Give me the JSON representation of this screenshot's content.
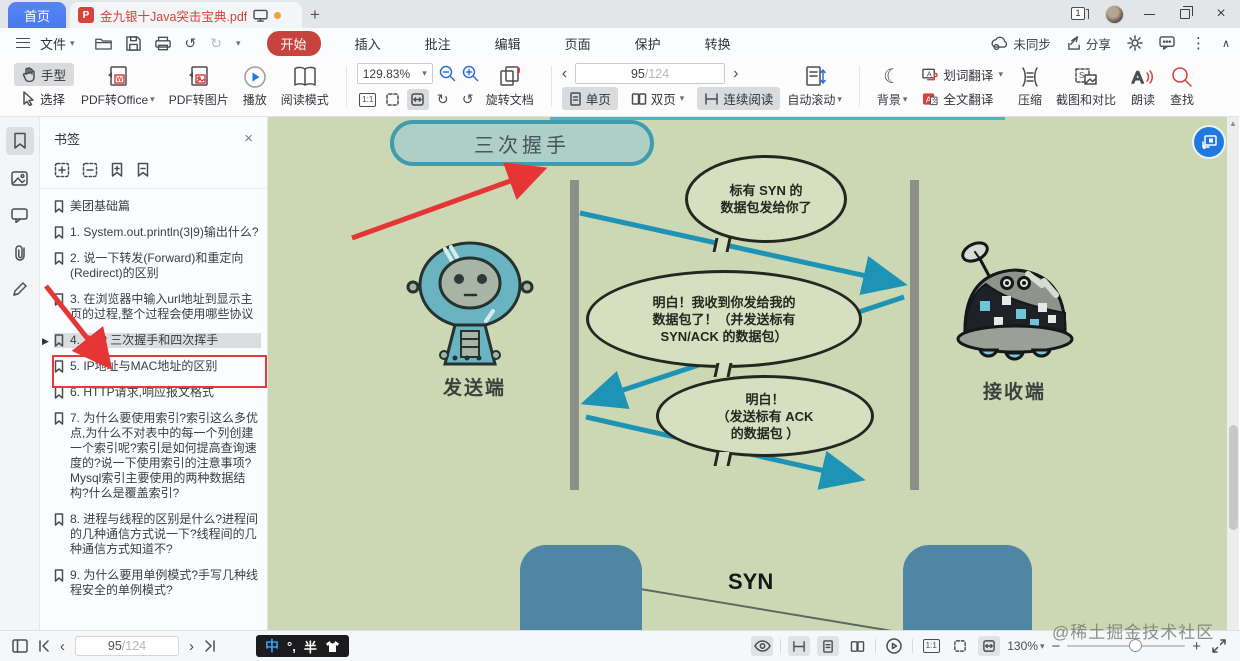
{
  "glyphs": {
    "caret_down": "▾",
    "chev_left": "‹",
    "chev_right": "›",
    "undo": "↺",
    "redo": "↻",
    "rotate_cw": "↻",
    "rotate_ccw": "↺",
    "play": "▶",
    "moon": "☾",
    "dots": "⋮",
    "close": "×",
    "minus": "−",
    "plus": "+",
    "chev_up": "∧",
    "tri_right": "▶",
    "scroll_up": "▲",
    "new_tab": "+"
  },
  "titlebar": {
    "home_tab": "首页",
    "doc_tab": "金九银十Java突击宝典.pdf",
    "window_count": "1"
  },
  "menubar": {
    "file_label": "文件",
    "tabs": [
      "开始",
      "插入",
      "批注",
      "编辑",
      "页面",
      "保护",
      "转换"
    ],
    "sync_label": "未同步",
    "share_label": "分享"
  },
  "ribbon": {
    "hand": "手型",
    "select": "选择",
    "pdf_to_office": "PDF转Office",
    "pdf_to_image": "PDF转图片",
    "play": "播放",
    "read_mode": "阅读模式",
    "zoom_value": "129.83%",
    "rotate_doc": "旋转文档",
    "single_page": "单页",
    "double_page": "双页",
    "continuous": "连续阅读",
    "auto_scroll": "自动滚动",
    "background": "背景",
    "word_translate": "划词翻译",
    "full_translate": "全文翻译",
    "compress": "压缩",
    "screenshot_compare": "截图和对比",
    "read_aloud": "朗读",
    "find": "查找"
  },
  "paging": {
    "current": "95",
    "sep": "/",
    "total": "124"
  },
  "sidebar": {
    "panel_title": "书签",
    "items": [
      {
        "label": "美团基础篇"
      },
      {
        "label": "1. System.out.println(3|9)输出什么?"
      },
      {
        "label": "2. 说一下转发(Forward)和重定向(Redirect)的区别"
      },
      {
        "label": "3. 在浏览器中输入url地址到显示主页的过程,整个过程会使用哪些协议"
      },
      {
        "label": "4. TCP 三次握手和四次挥手"
      },
      {
        "label": "5. IP地址与MAC地址的区别"
      },
      {
        "label": "6. HTTP请求,响应报文格式"
      },
      {
        "label": "7. 为什么要使用索引?索引这么多优点,为什么不对表中的每一个列创建一个索引呢?索引是如何提高查询速度的?说一下使用索引的注意事项?Mysql索引主要使用的两种数据结构?什么是覆盖索引?"
      },
      {
        "label": "8. 进程与线程的区别是什么?进程间的几种通信方式说一下?线程间的几种通信方式知道不?"
      },
      {
        "label": "9. 为什么要用单例模式?手写几种线程安全的单例模式?"
      }
    ]
  },
  "document": {
    "title_box": "三次握手",
    "bubbles": [
      {
        "lines": [
          "标有 SYN 的",
          "数据包发给你了"
        ]
      },
      {
        "lines": [
          "明白！我收到你发给我的",
          "数据包了！（并发送标有",
          "SYN/ACK 的数据包）"
        ]
      },
      {
        "lines": [
          "明白！",
          "（发送标有 ACK",
          "的数据包 ）"
        ]
      }
    ],
    "sender_label": "发送端",
    "receiver_label": "接收端",
    "syn_label": "SYN",
    "watermark": "@稀土掘金技术社区"
  },
  "statusbar": {
    "ime_lang": "中",
    "ime_punct": "°,",
    "ime_width": "半",
    "zoom_value": "130%"
  },
  "colors": {
    "accent_red": "#c7433d",
    "tab_blue": "#4a79f0",
    "page_green": "#ccd8b4",
    "diagram_teal": "#1d93b6",
    "annotation_red": "#e63535",
    "steel_blue": "#4e86a4"
  }
}
